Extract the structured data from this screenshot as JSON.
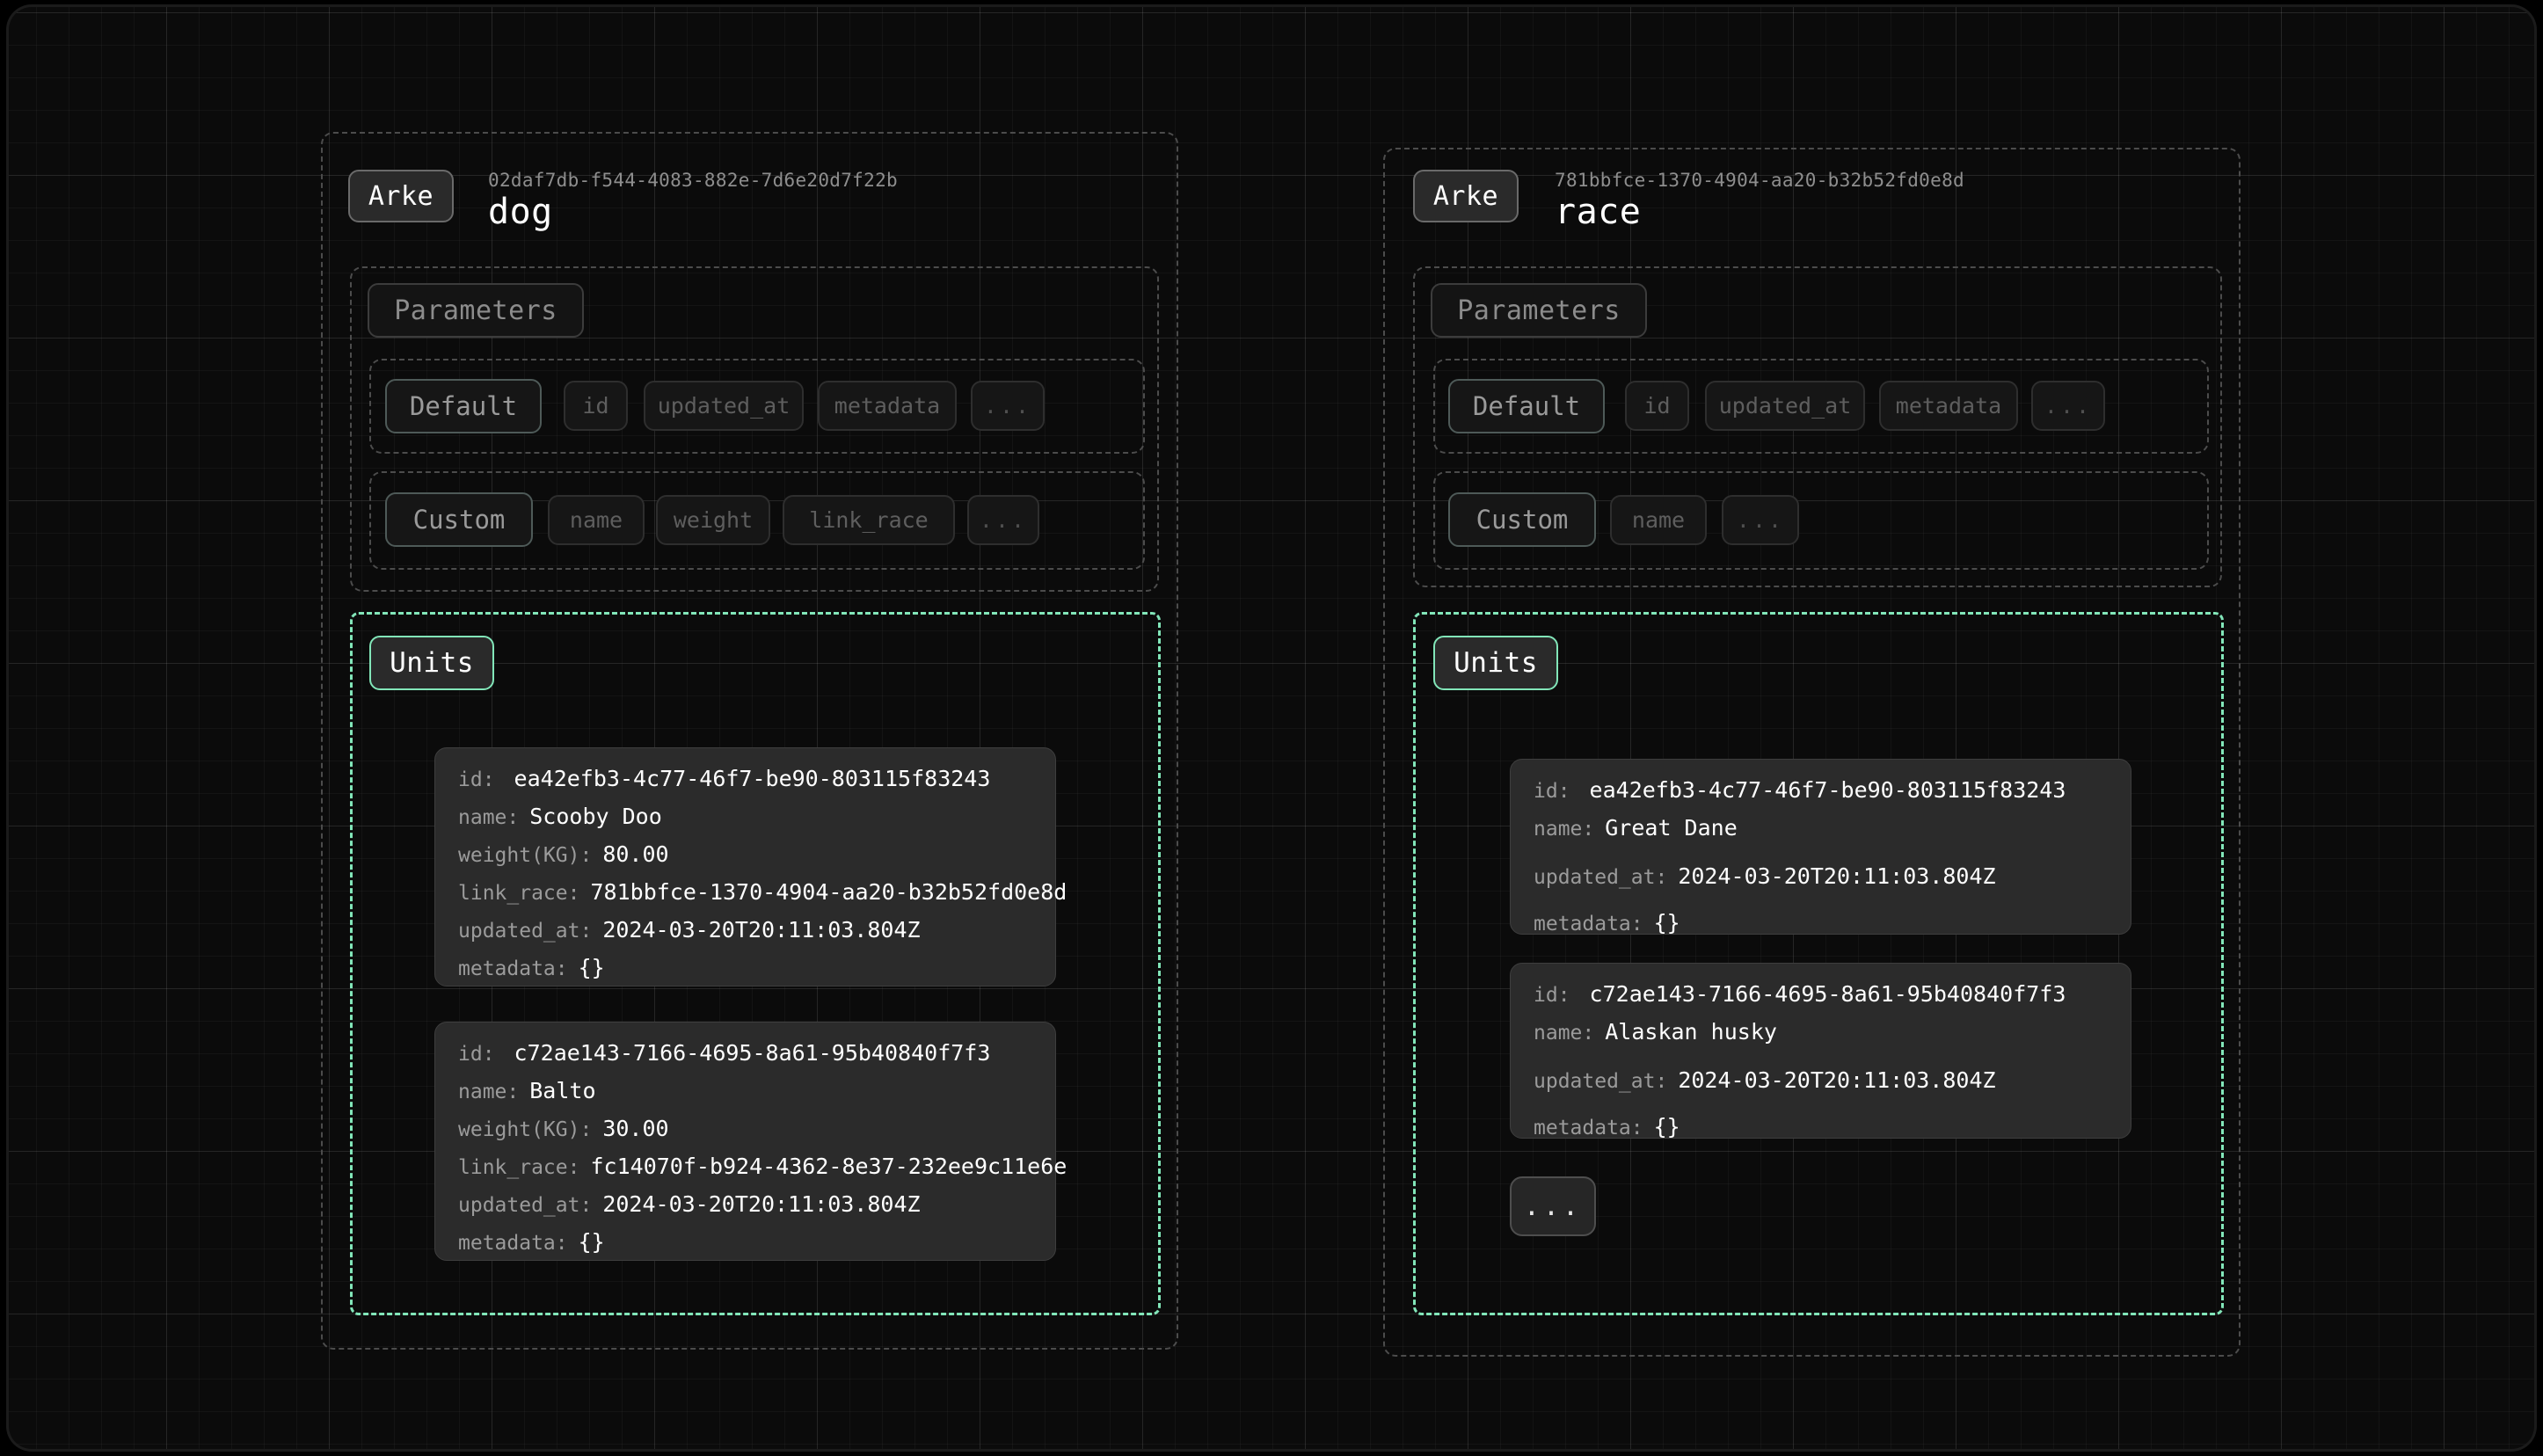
{
  "canvas": {
    "background": "#0b0b0b",
    "accent": "#82e6b9",
    "grid": "on"
  },
  "panels": [
    {
      "badge": "Arke",
      "uuid": "02daf7db-f544-4083-882e-7d6e20d7f22b",
      "name": "dog",
      "parameters": {
        "label": "Parameters",
        "groups": [
          {
            "label": "Default",
            "items": [
              "id",
              "updated_at",
              "metadata",
              "..."
            ]
          },
          {
            "label": "Custom",
            "items": [
              "name",
              "weight",
              "link_race",
              "..."
            ]
          }
        ]
      },
      "units": {
        "label": "Units",
        "cards": [
          {
            "rows": [
              {
                "key": "id:",
                "value": "ea42efb3-4c77-46f7-be90-803115f83243"
              },
              {
                "key": "name:",
                "value": "Scooby Doo"
              },
              {
                "key": "weight(KG):",
                "value": "80.00"
              },
              {
                "key": "link_race:",
                "value": "781bbfce-1370-4904-aa20-b32b52fd0e8d"
              },
              {
                "key": "updated_at:",
                "value": "2024-03-20T20:11:03.804Z"
              },
              {
                "key": "metadata:",
                "value": "{}"
              }
            ]
          },
          {
            "rows": [
              {
                "key": "id:",
                "value": "c72ae143-7166-4695-8a61-95b40840f7f3"
              },
              {
                "key": "name:",
                "value": "Balto"
              },
              {
                "key": "weight(KG):",
                "value": "30.00"
              },
              {
                "key": "link_race:",
                "value": "fc14070f-b924-4362-8e37-232ee9c11e6e"
              },
              {
                "key": "updated_at:",
                "value": "2024-03-20T20:11:03.804Z"
              },
              {
                "key": "metadata:",
                "value": "{}"
              }
            ]
          }
        ],
        "more": null
      }
    },
    {
      "badge": "Arke",
      "uuid": "781bbfce-1370-4904-aa20-b32b52fd0e8d",
      "name": "race",
      "parameters": {
        "label": "Parameters",
        "groups": [
          {
            "label": "Default",
            "items": [
              "id",
              "updated_at",
              "metadata",
              "..."
            ]
          },
          {
            "label": "Custom",
            "items": [
              "name",
              "..."
            ]
          }
        ]
      },
      "units": {
        "label": "Units",
        "cards": [
          {
            "rows": [
              {
                "key": "id:",
                "value": "ea42efb3-4c77-46f7-be90-803115f83243"
              },
              {
                "key": "name:",
                "value": "Great Dane"
              },
              {
                "key": "updated_at:",
                "value": "2024-03-20T20:11:03.804Z"
              },
              {
                "key": "metadata:",
                "value": "{}"
              }
            ]
          },
          {
            "rows": [
              {
                "key": "id:",
                "value": "c72ae143-7166-4695-8a61-95b40840f7f3"
              },
              {
                "key": "name:",
                "value": "Alaskan husky"
              },
              {
                "key": "updated_at:",
                "value": "2024-03-20T20:11:03.804Z"
              },
              {
                "key": "metadata:",
                "value": "{}"
              }
            ]
          }
        ],
        "more": "..."
      }
    }
  ]
}
